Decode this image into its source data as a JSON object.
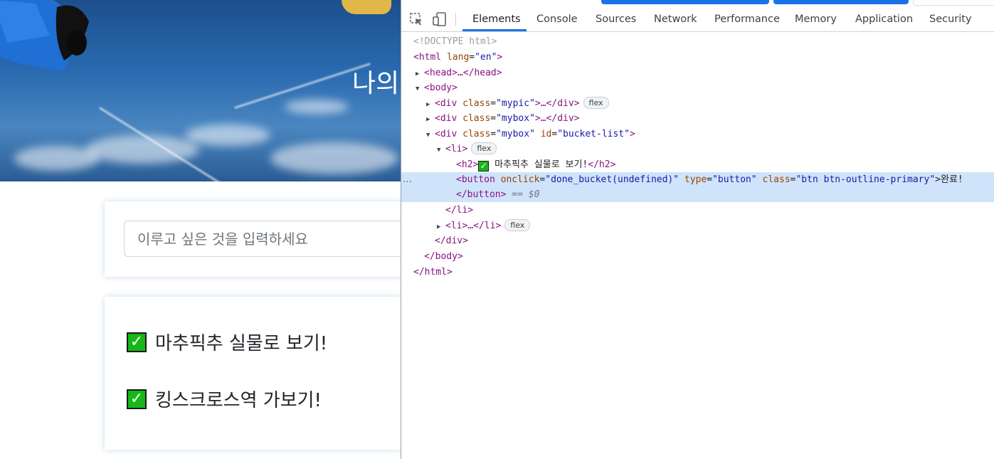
{
  "page": {
    "hero_title": "나의",
    "input_placeholder": "이루고 싶은 것을 입력하세요",
    "bucket_items": [
      {
        "icon": "green-check-icon",
        "text": "마추픽추 실물로 보기!"
      },
      {
        "icon": "green-check-icon",
        "text": "킹스크로스역 가보기!"
      }
    ]
  },
  "devtools": {
    "toolbar_icons": [
      "inspect-element-icon",
      "device-toolbar-icon"
    ],
    "tabs": [
      "Elements",
      "Console",
      "Sources",
      "Network",
      "Performance",
      "Memory",
      "Application",
      "Security"
    ],
    "active_tab": "Elements",
    "dom": {
      "doctype": "<!DOCTYPE html>",
      "html_open_tag": "<html",
      "html_lang_attr": "lang",
      "html_lang_val": "\"en\"",
      "html_open_close": ">",
      "head_line": "<head>…</head>",
      "body_open": "<body>",
      "div1_open": "<div",
      "div_class_attr": "class",
      "div1_class_val": "\"mypic\"",
      "div1_tail": ">…</div>",
      "div2_class_val": "\"mybox\"",
      "div2_tail": ">…</div>",
      "div3_class_val": "\"mybox\"",
      "div3_id_attr": "id",
      "div3_id_val": "\"bucket-list\"",
      "div3_tail": ">",
      "li_open": "<li>",
      "h2_open": "<h2>",
      "h2_text": "마추픽추 실물로 보기!",
      "h2_close": "</h2>",
      "button_open": "<button",
      "onclick_attr": "onclick",
      "onclick_val": "\"done_bucket(undefined)\"",
      "type_attr": "type",
      "type_val": "\"button\"",
      "class_attr": "class",
      "btn_class_val": "\"btn btn-outline-primary\"",
      "button_text": ">완료!",
      "button_close": "</button>",
      "dollar_zero": "== $0",
      "li_close": "</li>",
      "li2_line": "<li>…</li>",
      "div_close": "</div>",
      "body_close": "</body>",
      "html_close": "</html>",
      "flex_badge": "flex",
      "ellipsis": "…"
    }
  },
  "colors": {
    "accent_blue": "#1a73e8",
    "selected_row": "#cfe3fb",
    "check_green": "#16b816",
    "tag_purple": "#881280",
    "attr_brown": "#994500",
    "value_blue": "#1a1aa6"
  }
}
